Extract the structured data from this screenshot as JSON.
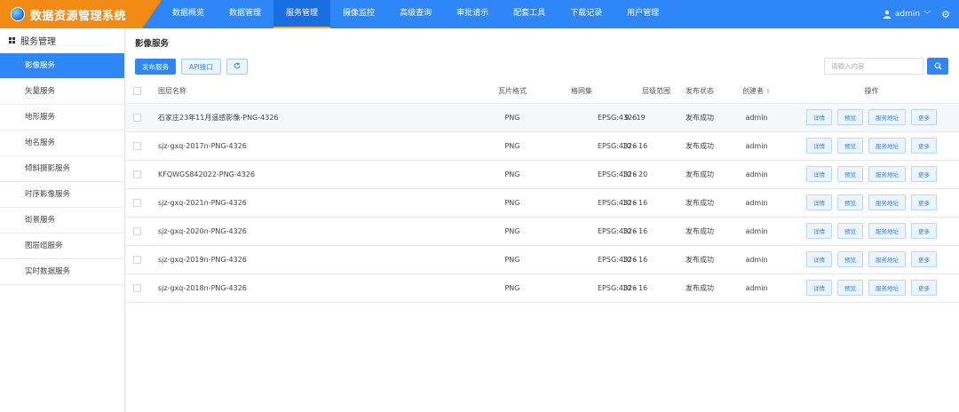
{
  "app": {
    "title": "数据资源管理系统",
    "logo_icon": "globe-icon"
  },
  "nav": {
    "items": [
      {
        "label": "数据概览",
        "active": false
      },
      {
        "label": "数据管理",
        "active": false
      },
      {
        "label": "服务管理",
        "active": true
      },
      {
        "label": "摄像监控",
        "active": false
      },
      {
        "label": "高级查询",
        "active": false
      },
      {
        "label": "审批请示",
        "active": false
      },
      {
        "label": "配套工具",
        "active": false
      },
      {
        "label": "下载记录",
        "active": false
      },
      {
        "label": "用户管理",
        "active": false
      }
    ]
  },
  "user": {
    "name": "admin"
  },
  "sidebar": {
    "title": "服务管理",
    "items": [
      {
        "label": "影像服务",
        "active": true
      },
      {
        "label": "矢量服务",
        "active": false
      },
      {
        "label": "地形服务",
        "active": false
      },
      {
        "label": "地名服务",
        "active": false
      },
      {
        "label": "倾斜摄影服务",
        "active": false
      },
      {
        "label": "时序影像服务",
        "active": false
      },
      {
        "label": "街景服务",
        "active": false
      },
      {
        "label": "图层组服务",
        "active": false
      },
      {
        "label": "实时数据服务",
        "active": false
      }
    ]
  },
  "main": {
    "title": "影像服务",
    "toolbar": {
      "publish_label": "发布服务",
      "api_label": "API接口",
      "refresh_icon": "refresh-icon"
    },
    "search": {
      "placeholder": "请输入内容",
      "value": ""
    },
    "table": {
      "headers": {
        "name": "图层名称",
        "format": "瓦片格式",
        "gridset": "格网集",
        "levels": "层级范围",
        "status": "发布状态",
        "creator": "创建者",
        "actions": "操作"
      },
      "action_labels": [
        "详情",
        "预览",
        "服务地址",
        "更多"
      ],
      "rows": [
        {
          "name": "石家庄23年11月遥感影像-PNG-4326",
          "format": "PNG",
          "gridset": "EPSG:4326",
          "levels": "9 - 19",
          "status": "发布成功",
          "creator": "admin"
        },
        {
          "name": "sjz-gxq-2017n-PNG-4326",
          "format": "PNG",
          "gridset": "EPSG:4326",
          "levels": "10 - 16",
          "status": "发布成功",
          "creator": "admin"
        },
        {
          "name": "KFQWGS842022-PNG-4326",
          "format": "PNG",
          "gridset": "EPSG:4326",
          "levels": "10 - 20",
          "status": "发布成功",
          "creator": "admin"
        },
        {
          "name": "sjz-gxq-2021n-PNG-4326",
          "format": "PNG",
          "gridset": "EPSG:4326",
          "levels": "10 - 16",
          "status": "发布成功",
          "creator": "admin"
        },
        {
          "name": "sjz-gxq-2020n-PNG-4326",
          "format": "PNG",
          "gridset": "EPSG:4326",
          "levels": "10 - 16",
          "status": "发布成功",
          "creator": "admin"
        },
        {
          "name": "sjz-gxq-2019n-PNG-4326",
          "format": "PNG",
          "gridset": "EPSG:4326",
          "levels": "10 - 16",
          "status": "发布成功",
          "creator": "admin"
        },
        {
          "name": "sjz-gxq-2018n-PNG-4326",
          "format": "PNG",
          "gridset": "EPSG:4326",
          "levels": "10 - 16",
          "status": "发布成功",
          "creator": "admin"
        }
      ]
    }
  },
  "colors": {
    "primary": "#2f86f6",
    "brand": "#f08a15"
  }
}
